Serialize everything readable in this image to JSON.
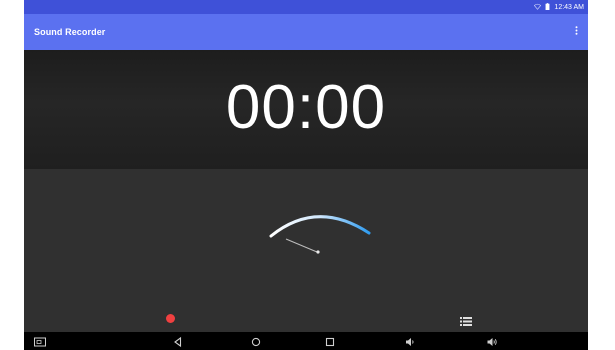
{
  "status_bar": {
    "time": "12:43 AM",
    "icons": [
      "wifi-icon",
      "battery-icon"
    ]
  },
  "app_bar": {
    "title": "Sound Recorder",
    "overflow_icon": "more-vert-icon"
  },
  "timer": {
    "elapsed": "00:00"
  },
  "controls": {
    "record_icon": "record-dot-icon",
    "recordings_list_icon": "list-icon"
  },
  "nav_bar": {
    "items": [
      "screenshot-icon",
      "back-icon",
      "home-icon",
      "recents-icon",
      "volume-down-icon",
      "volume-up-icon"
    ]
  },
  "colors": {
    "status_bar": "#3f51d8",
    "app_bar": "#5b71f0",
    "timer_panel": "#232323",
    "main_panel": "#303030",
    "record_dot": "#f04040",
    "meter_arc": "#42a5f5"
  }
}
